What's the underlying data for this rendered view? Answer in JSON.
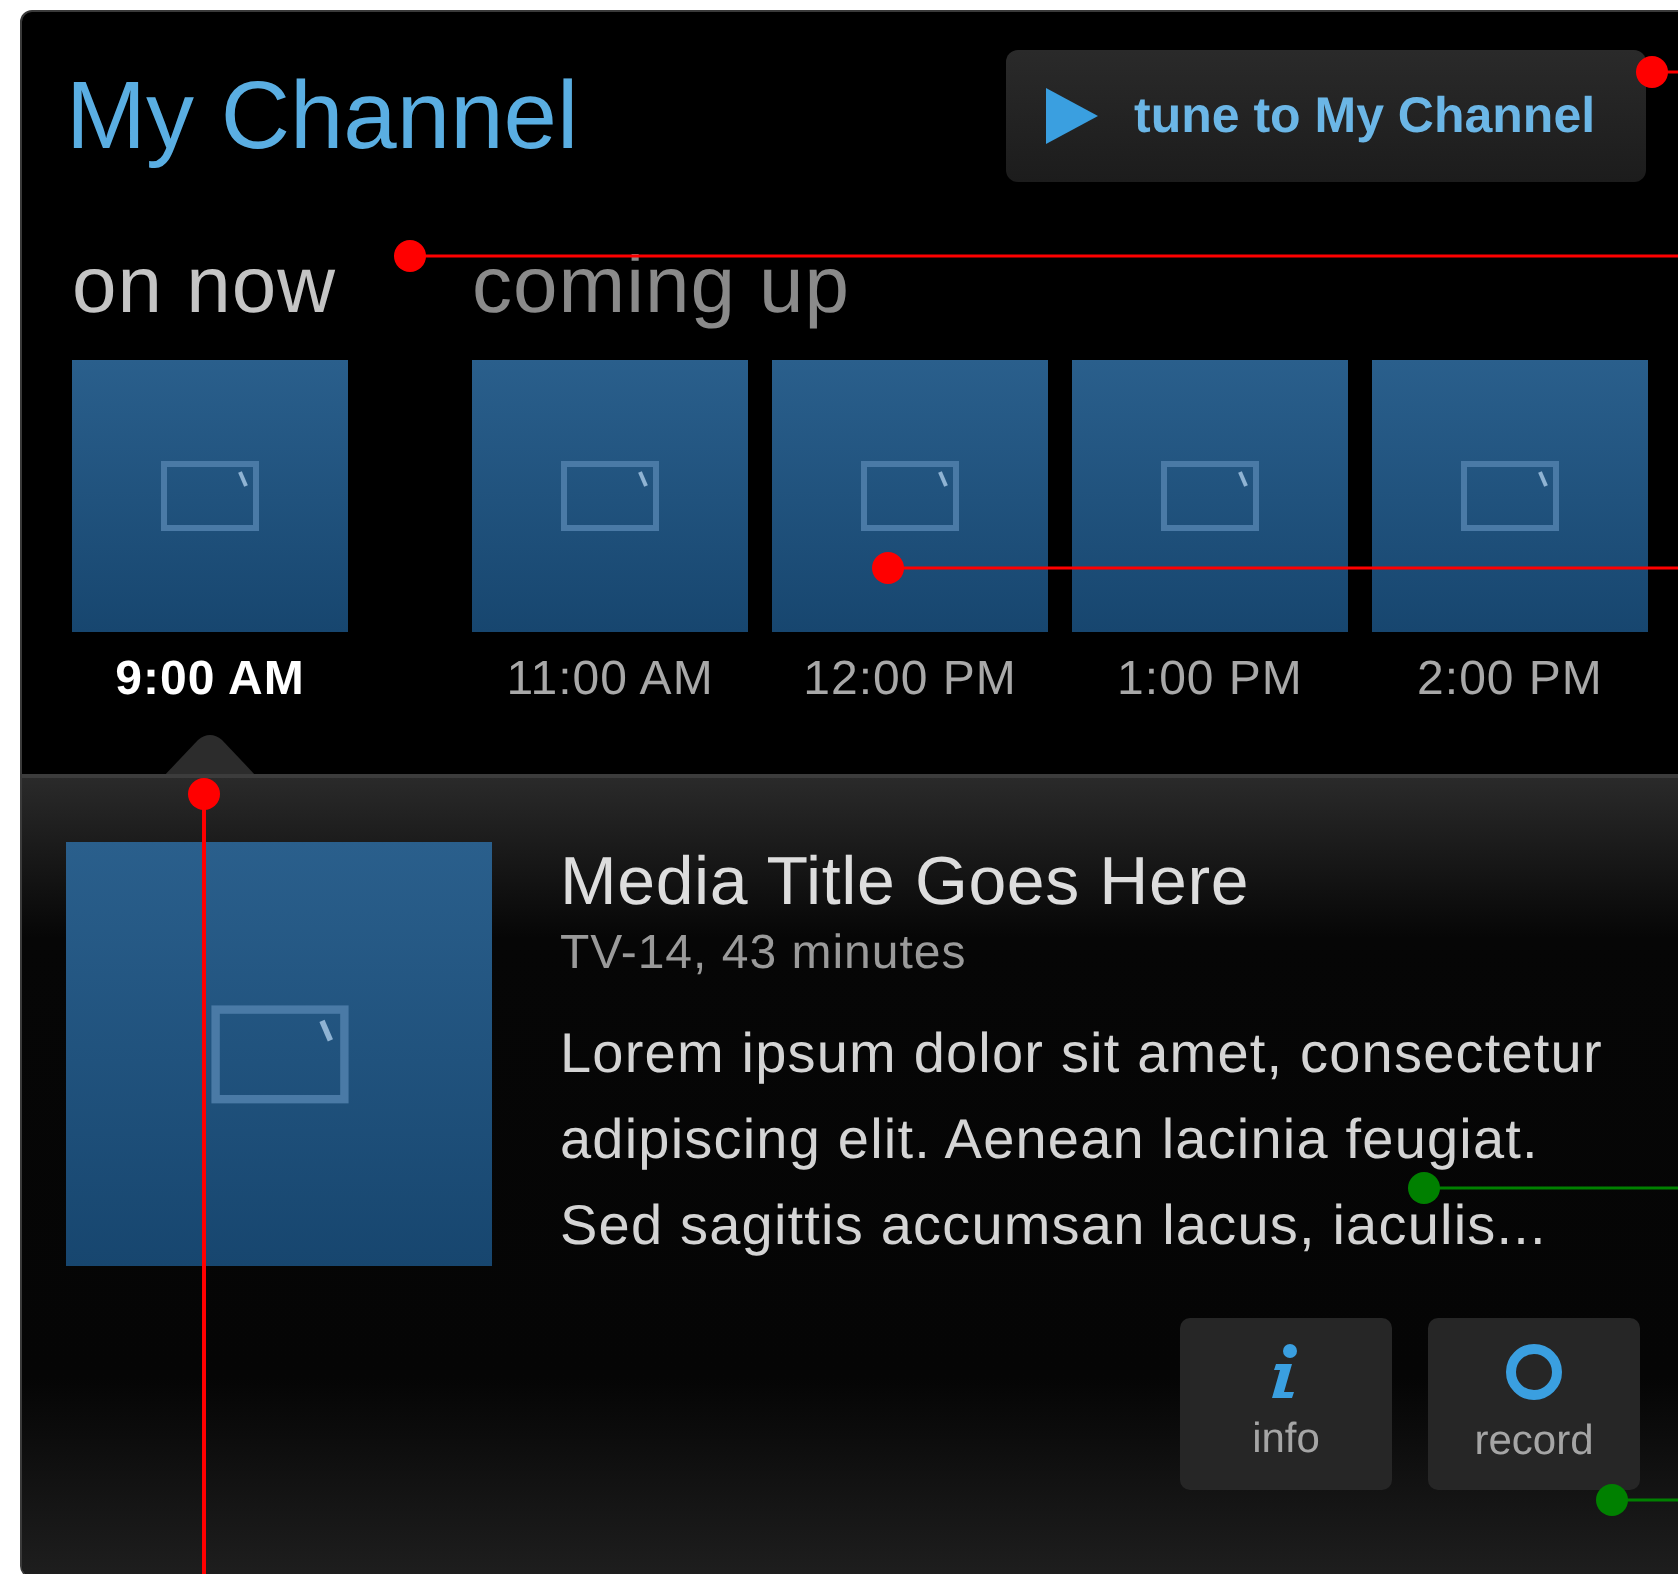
{
  "header": {
    "title": "My Channel",
    "tune_button": "tune to My Channel"
  },
  "on_now": {
    "label": "on now",
    "items": [
      {
        "time": "9:00 AM",
        "selected": true
      }
    ]
  },
  "coming_up": {
    "label": "coming up",
    "items": [
      {
        "time": "11:00 AM",
        "selected": false
      },
      {
        "time": "12:00 PM",
        "selected": false
      },
      {
        "time": "1:00 PM",
        "selected": false
      },
      {
        "time": "2:00 PM",
        "selected": false
      }
    ]
  },
  "detail": {
    "title": "Media Title Goes Here",
    "meta": "TV-14, 43 minutes",
    "description": "Lorem ipsum dolor sit amet, consectetur adipiscing elit. Aenean lacinia feugiat. Sed sagittis accumsan lacus, iaculis...",
    "buttons": [
      {
        "kind": "info",
        "label": "info"
      },
      {
        "kind": "record",
        "label": "record"
      }
    ]
  },
  "annotations": [
    {
      "kind": "horizontal",
      "color": "#ff0000"
    },
    {
      "kind": "horizontal",
      "color": "#ff0000"
    },
    {
      "kind": "horizontal",
      "color": "#ff0000"
    },
    {
      "kind": "vertical",
      "color": "#ff0000"
    },
    {
      "kind": "horizontal",
      "color": "#008000"
    },
    {
      "kind": "horizontal",
      "color": "#008000"
    }
  ]
}
